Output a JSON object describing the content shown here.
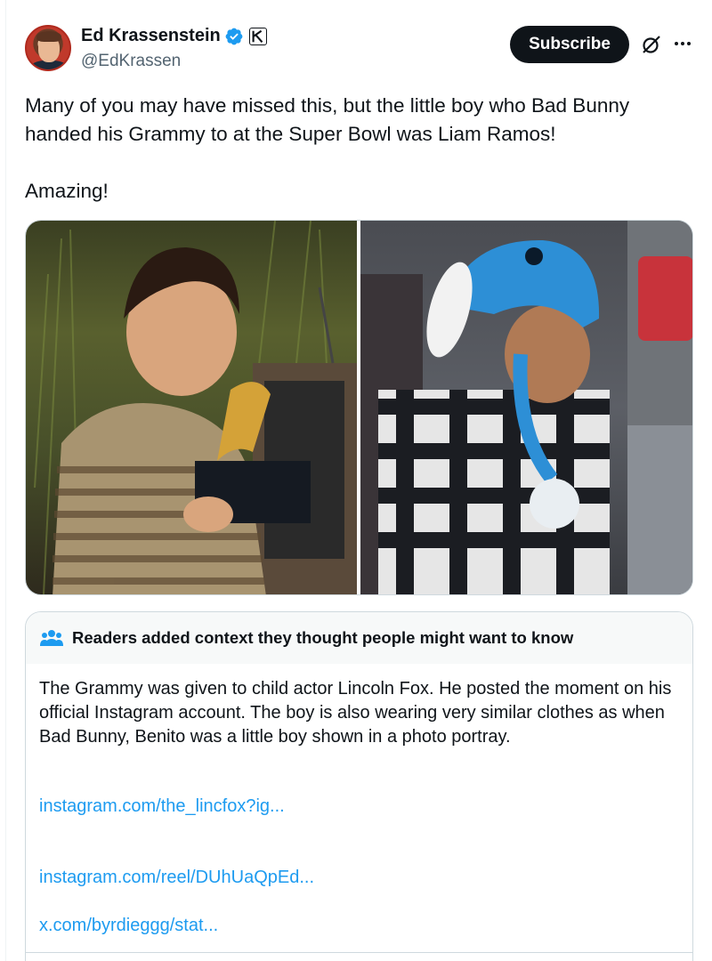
{
  "author": {
    "display_name": "Ed Krassenstein",
    "handle": "@EdKrassen",
    "verified_color": "#1d9bf0"
  },
  "actions": {
    "subscribe_label": "Subscribe"
  },
  "tweet": {
    "paragraphs": [
      "Many of you may have missed this, but the little boy who Bad Bunny handed his Grammy to at the Super Bowl was Liam Ramos!",
      "Amazing!"
    ]
  },
  "media": {
    "photos": [
      {
        "description_icon": "photo-boy-with-grammy"
      },
      {
        "description_icon": "photo-boy-in-blue-hat"
      }
    ]
  },
  "community_note": {
    "title": "Readers added context they thought people might want to know",
    "body": "The Grammy was given to child actor Lincoln Fox. He posted the moment on his official Instagram account. The boy is also wearing very similar  clothes as when Bad Bunny, Benito was a little boy shown in a photo portray.",
    "links": [
      "instagram.com/the_lincfox?ig...",
      "instagram.com/reel/DUhUaQpEd...",
      "x.com/byrdieggg/stat..."
    ],
    "link_color": "#1d9bf0"
  }
}
